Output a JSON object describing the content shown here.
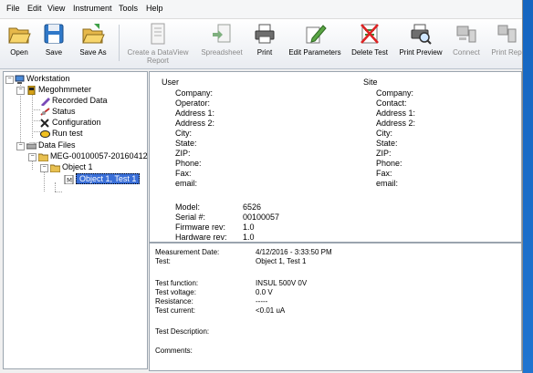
{
  "menu": [
    "File",
    "Edit",
    "View",
    "Instrument",
    "Tools",
    "Help"
  ],
  "toolbar": {
    "open": "Open",
    "save": "Save",
    "save_as": "Save As",
    "create_report_line1": "Create a DataView",
    "create_report_line2": "Report",
    "spreadsheet": "Spreadsheet",
    "print": "Print",
    "edit_parameters": "Edit Parameters",
    "delete_test": "Delete Test",
    "print_preview": "Print Preview",
    "connect": "Connect",
    "print_report": "Print Rep"
  },
  "tree": {
    "workstation": "Workstation",
    "megohmmeter": "Megohmmeter",
    "recorded_data": "Recorded Data",
    "status": "Status",
    "configuration": "Configuration",
    "run_test": "Run test",
    "data_files": "Data Files",
    "file_name": "MEG-00100057-20160412",
    "object": "Object 1",
    "test_node": "Object 1, Test 1"
  },
  "user": {
    "heading": "User",
    "fields": [
      "Company:",
      "Operator:",
      "Address 1:",
      "Address 2:",
      "City:",
      "State:",
      "ZIP:",
      "Phone:",
      "Fax:",
      "email:"
    ]
  },
  "site": {
    "heading": "Site",
    "fields": [
      "Company:",
      "Contact:",
      "Address 1:",
      "Address 2:",
      "City:",
      "State:",
      "ZIP:",
      "Phone:",
      "Fax:",
      "email:"
    ]
  },
  "instrument": {
    "labels": [
      "Model:",
      "Serial #:",
      "Firmware rev:",
      "Hardware rev:"
    ],
    "values": [
      "6526",
      "00100057",
      "1.0",
      "1.0"
    ]
  },
  "measurement": {
    "date_label": "Measurement Date:",
    "date_value": "4/12/2016 - 3:33:50 PM",
    "test_label": "Test:",
    "test_value": "Object 1, Test 1",
    "function_label": "Test function:",
    "function_value": "INSUL 500V 0V",
    "voltage_label": "Test voltage:",
    "voltage_value": "0.0 V",
    "resistance_label": "Resistance:",
    "resistance_value": "-----",
    "current_label": "Test current:",
    "current_value": "<0.01 uA",
    "description_label": "Test Description:",
    "comments_label": "Comments:"
  },
  "colors": {
    "selection": "#3a6fd8",
    "accent_edge": "#1565c0"
  }
}
